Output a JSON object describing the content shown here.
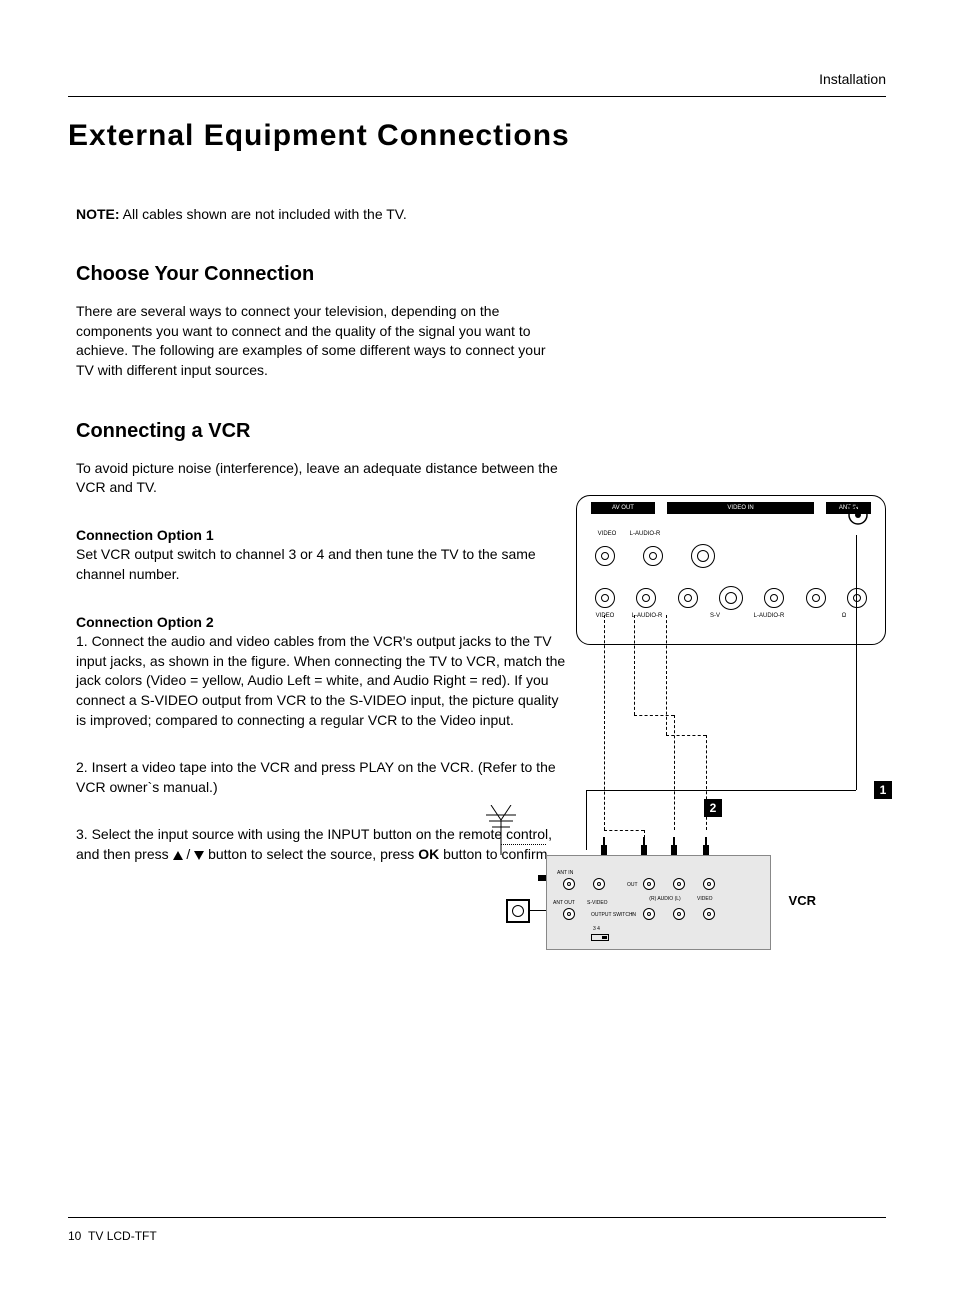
{
  "header": {
    "section_label": "Installation"
  },
  "title": "External Equipment Connections",
  "note": {
    "label": "NOTE:",
    "text": " All cables shown are not included with the TV."
  },
  "choose": {
    "heading": "Choose Your Connection",
    "body": "There are several ways to connect your television, depending on the components you want to connect and the quality of the signal you want to achieve.  The following are examples of some different ways to connect your TV with different input sources."
  },
  "vcr": {
    "heading": "Connecting a VCR",
    "intro": "To avoid picture noise (interference), leave an adequate distance between the VCR and TV.",
    "opt1_title": "Connection Option 1",
    "opt1_body": "Set VCR output switch to channel 3 or 4 and then tune the TV to the same channel number.",
    "opt2_title": "Connection Option 2",
    "opt2_step1": "1. Connect the audio and video cables from the VCR's output jacks to the TV input jacks, as shown in the figure. When connecting the TV to VCR, match the jack colors (Video = yellow, Audio Left = white, and Audio Right = red). If you connect a S-VIDEO output from VCR to the S-VIDEO input, the picture quality is improved; compared to connecting a regular VCR to the Video input.",
    "opt2_step2": "2. Insert a video tape into the VCR and press PLAY on the VCR. (Refer to the VCR owner`s manual.)",
    "opt2_step3_a": "3. Select the input source with using the INPUT button on the remote control, and then press ",
    "opt2_step3_b": " button to select the source, press ",
    "opt2_step3_ok": "OK",
    "opt2_step3_c": " button to confirm."
  },
  "diagram": {
    "port_avout": "AV OUT",
    "port_videoin": "VIDEO IN",
    "port_antin": "ANT IN",
    "lbl_video": "VIDEO",
    "lbl_laudior": "L-AUDIO-R",
    "lbl_sv": "S-V",
    "lbl_hp": "Ω",
    "vcr_label": "VCR",
    "vcr_antin": "ANT IN",
    "vcr_antout": "ANT OUT",
    "vcr_svideo": "S-VIDEO",
    "vcr_out": "OUT",
    "vcr_in": "IN",
    "vcr_raudiol": "(R) AUDIO (L)",
    "vcr_vid": "VIDEO",
    "vcr_switch": "OUTPUT SWITCH",
    "vcr_switch34": "3   4",
    "marker1": "1",
    "marker2": "2"
  },
  "footer": {
    "page": "10",
    "model": "TV LCD-TFT"
  }
}
